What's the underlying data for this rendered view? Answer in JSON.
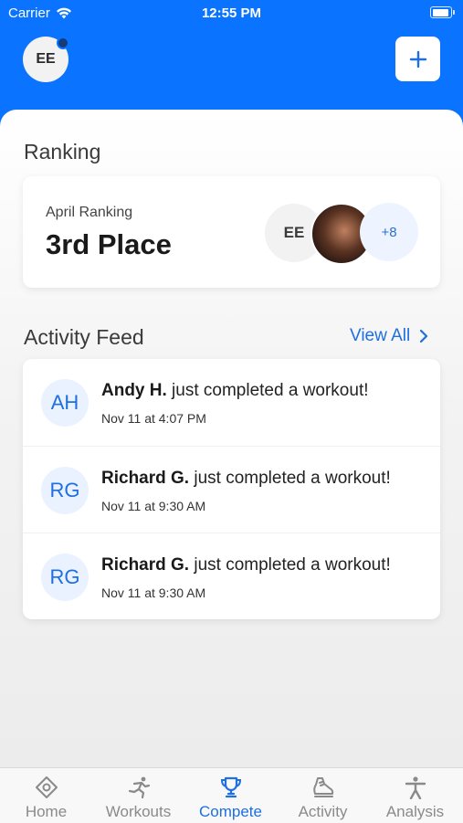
{
  "status_bar": {
    "carrier": "Carrier",
    "time": "12:55 PM"
  },
  "header": {
    "avatar_initials": "EE"
  },
  "ranking": {
    "title": "Ranking",
    "label": "April Ranking",
    "value": "3rd Place",
    "participants": {
      "initials": "EE",
      "more": "+8"
    }
  },
  "feed": {
    "title": "Activity Feed",
    "view_all": "View All",
    "items": [
      {
        "initials": "AH",
        "name": "Andy H.",
        "action": " just completed a workout!",
        "time": "Nov 11 at 4:07 PM"
      },
      {
        "initials": "RG",
        "name": "Richard G.",
        "action": " just completed a workout!",
        "time": "Nov 11 at 9:30 AM"
      },
      {
        "initials": "RG",
        "name": "Richard G.",
        "action": " just completed a workout!",
        "time": "Nov 11 at 9:30 AM"
      }
    ]
  },
  "tabs": [
    {
      "label": "Home",
      "icon": "home-icon"
    },
    {
      "label": "Workouts",
      "icon": "running-icon"
    },
    {
      "label": "Compete",
      "icon": "trophy-icon",
      "active": true
    },
    {
      "label": "Activity",
      "icon": "shoe-icon"
    },
    {
      "label": "Analysis",
      "icon": "person-icon"
    }
  ],
  "colors": {
    "brand": "#0a73ff",
    "accent": "#1e6fe0",
    "inactive": "#8a8a8a"
  }
}
